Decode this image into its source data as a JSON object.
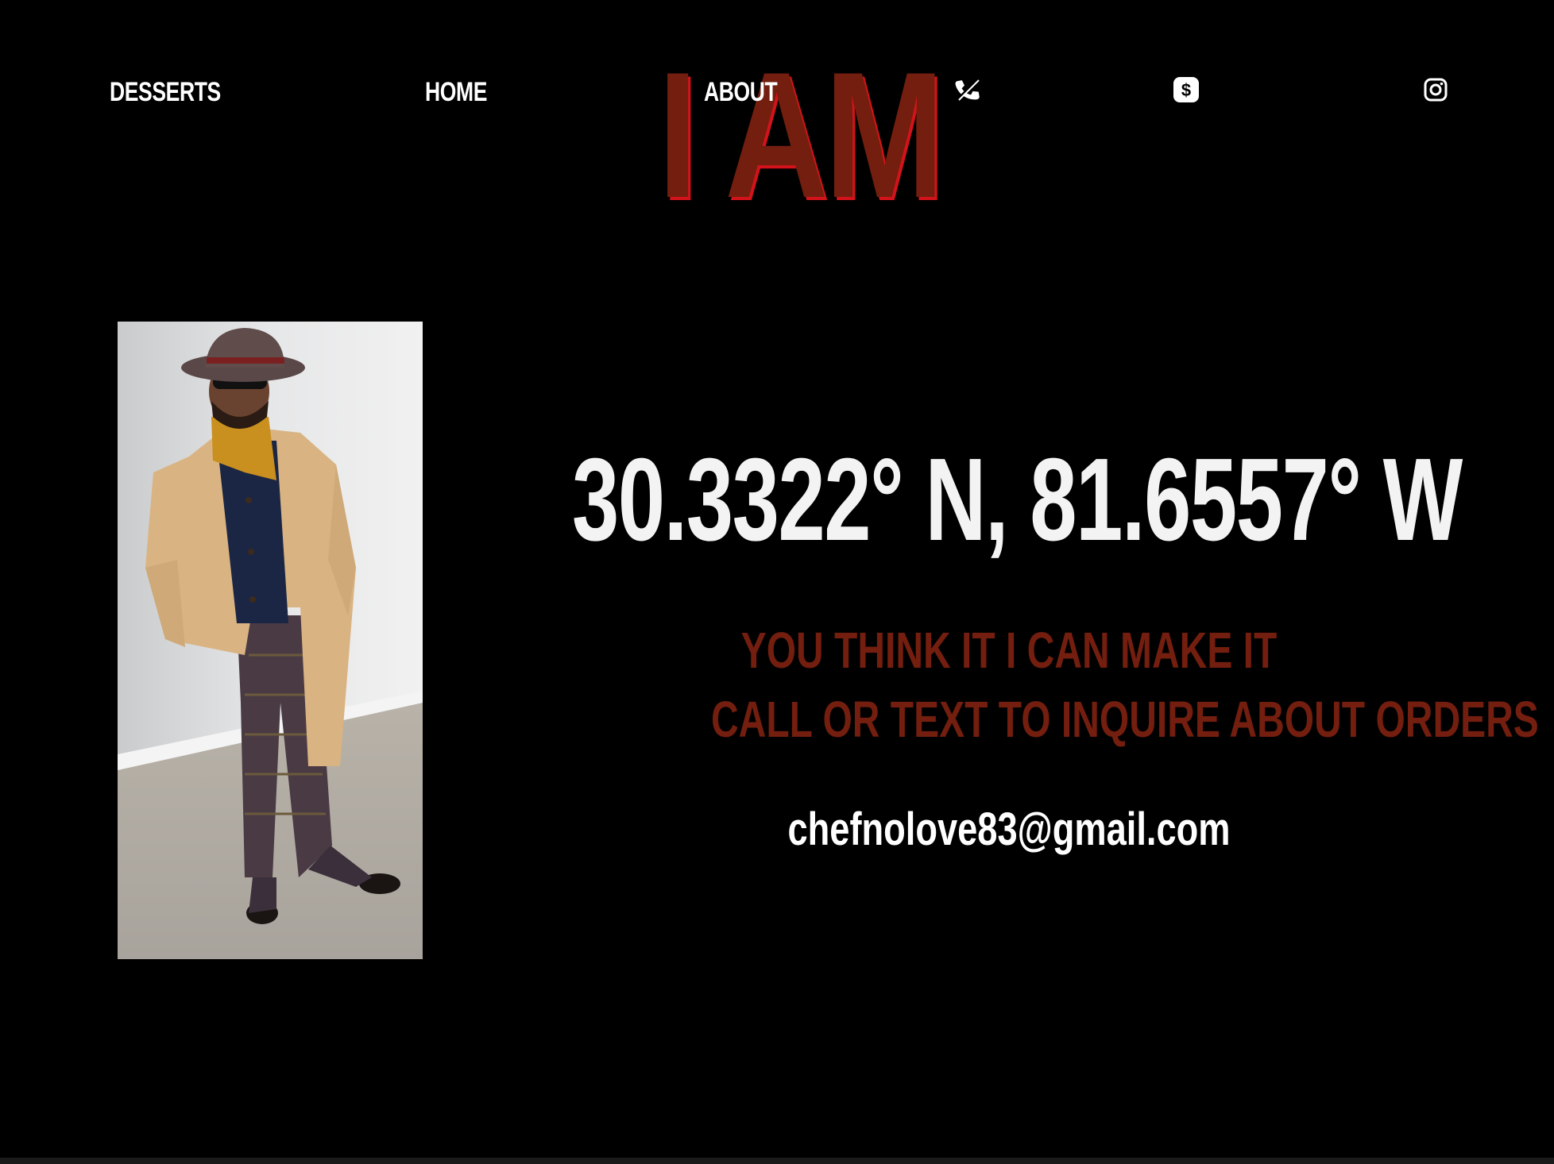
{
  "nav": {
    "links": [
      {
        "label": "DESSERTS"
      },
      {
        "label": "HOME"
      },
      {
        "label": "ABOUT"
      }
    ],
    "icons": [
      {
        "name": "phone-icon"
      },
      {
        "name": "cash-app-icon"
      },
      {
        "name": "instagram-icon"
      }
    ]
  },
  "brand": {
    "title": "I AM"
  },
  "main": {
    "coordinates": "30.3322° N, 81.6557° W",
    "tagline_line1": "YOU THINK IT I CAN MAKE IT",
    "tagline_line2": "CALL OR TEXT TO INQUIRE ABOUT ORDERS",
    "email": "chefnolove83@gmail.com"
  },
  "colors": {
    "background": "#000000",
    "accent": "#731e0e",
    "accent_shadow": "#d3131b",
    "text": "#ffffff"
  }
}
